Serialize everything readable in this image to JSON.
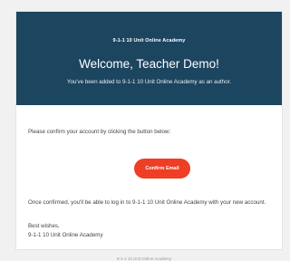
{
  "email": {
    "header": {
      "academy_name": "9-1-1 10 Unit Online Academy",
      "title": "Welcome, Teacher Demo!",
      "subtitle": "You've been added to 9-1-1 10 Unit Online Academy as an author."
    },
    "body": {
      "confirm_prompt": "Please confirm your account by clicking the button below:",
      "confirm_button": "Confirm Email",
      "once_confirmed": "Once confirmed, you'll be able to log in to 9-1-1 10 Unit Online Academy with your new account.",
      "sign_off": "Best wishes,",
      "sign_name": "9-1-1 10 Unit Online Academy"
    },
    "footer": {
      "text": "9-1-1 10 Unit Online Academy"
    }
  },
  "colors": {
    "header_bg": "#1c4560",
    "button_bg": "#ee3e26",
    "page_bg": "#f1f1f1"
  }
}
